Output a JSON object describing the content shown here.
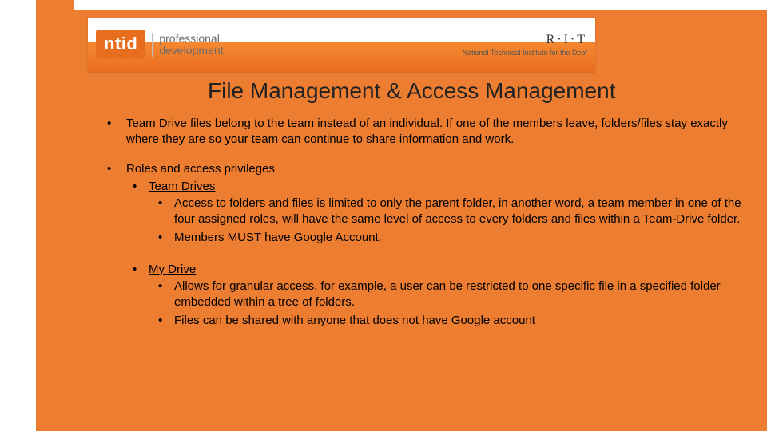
{
  "banner": {
    "logo_text": "ntid",
    "pd_line1": "professional",
    "pd_line2": "development",
    "rit": "R·I·T",
    "rit_sub": "National Technical Institute for the Deaf"
  },
  "title": "File Management & Access Management",
  "bullets": {
    "p1": "Team Drive files belong to the team instead of an individual. If one of the members leave, folders/files stay exactly where they are so your team can continue to share information and work.",
    "p2": "Roles and access privileges",
    "team_drives_label": "Team Drives",
    "td1": "Access to folders and files is limited to only the parent folder, in another word, a team member in one of the four assigned roles, will have the same level of access to every folders and files within a Team-Drive folder.",
    "td2": "Members MUST have Google Account.",
    "my_drive_label": "My Drive",
    "md1": "Allows for granular access, for example, a user can be restricted to one specific file in a specified folder embedded within a tree of folders.",
    "md2": "Files can be shared with anyone that does not have Google account"
  }
}
